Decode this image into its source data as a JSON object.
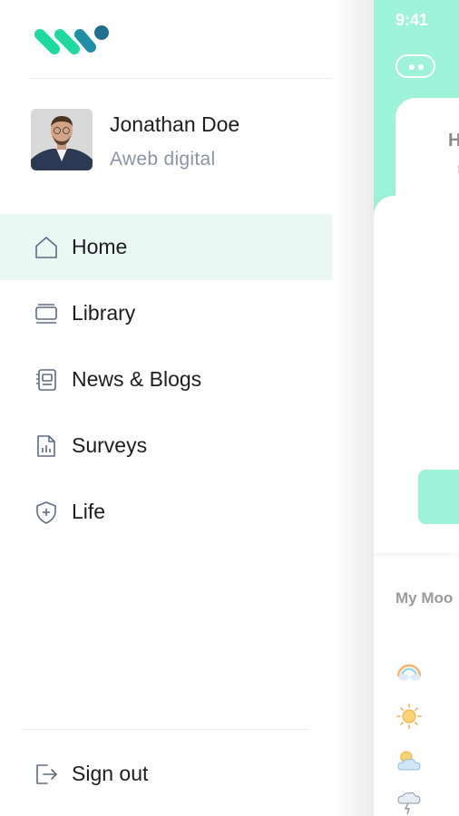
{
  "profile": {
    "name": "Jonathan Doe",
    "company": "Aweb digital"
  },
  "nav": {
    "items": [
      {
        "label": "Home",
        "icon": "home-icon",
        "active": true
      },
      {
        "label": "Library",
        "icon": "library-icon",
        "active": false
      },
      {
        "label": "News & Blogs",
        "icon": "news-icon",
        "active": false
      },
      {
        "label": "Surveys",
        "icon": "survey-icon",
        "active": false
      },
      {
        "label": "Life",
        "icon": "shield-icon",
        "active": false
      }
    ],
    "signout_label": "Sign out"
  },
  "preview": {
    "status_time": "9:41",
    "card_letter": "H",
    "card_sub": "f",
    "mood_label": "My Moo",
    "weather_icons": [
      "rainbow-icon",
      "sun-icon",
      "partly-cloudy-icon",
      "storm-icon"
    ]
  },
  "colors": {
    "mint": "#9df3d7",
    "active_bg": "#e9f8f2",
    "logo_green": "#1ed9a0",
    "logo_blue": "#1f6f8f",
    "text": "#1d1d1f",
    "muted": "#8a94a6"
  }
}
